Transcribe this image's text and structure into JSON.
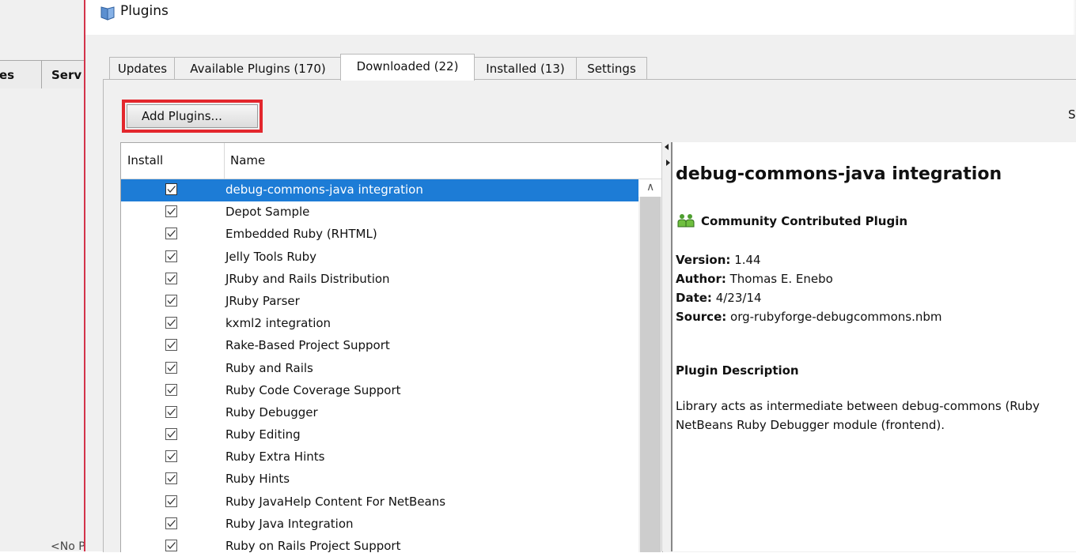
{
  "ide": {
    "tabs": [
      "es",
      "Serv"
    ],
    "placeholder": "<No P"
  },
  "dialog": {
    "title": "Plugins",
    "tabs": [
      {
        "label": "Updates"
      },
      {
        "label": "Available Plugins (170)"
      },
      {
        "label": "Downloaded (22)"
      },
      {
        "label": "Installed (13)"
      },
      {
        "label": "Settings"
      }
    ],
    "active_tab": "Downloaded (22)",
    "add_button": "Add Plugins...",
    "right_edge_text": "S",
    "table": {
      "headers": {
        "install": "Install",
        "name": "Name"
      },
      "rows": [
        {
          "name": "debug-commons-java integration",
          "checked": true,
          "selected": true
        },
        {
          "name": "Depot Sample",
          "checked": true
        },
        {
          "name": "Embedded Ruby (RHTML)",
          "checked": true
        },
        {
          "name": "Jelly Tools Ruby",
          "checked": true
        },
        {
          "name": "JRuby and Rails Distribution",
          "checked": true
        },
        {
          "name": "JRuby Parser",
          "checked": true
        },
        {
          "name": "kxml2 integration",
          "checked": true
        },
        {
          "name": "Rake-Based Project Support",
          "checked": true
        },
        {
          "name": "Ruby and Rails",
          "checked": true
        },
        {
          "name": "Ruby Code Coverage Support",
          "checked": true
        },
        {
          "name": "Ruby Debugger",
          "checked": true
        },
        {
          "name": "Ruby Editing",
          "checked": true
        },
        {
          "name": "Ruby Extra Hints",
          "checked": true
        },
        {
          "name": "Ruby Hints",
          "checked": true
        },
        {
          "name": "Ruby JavaHelp Content For NetBeans",
          "checked": true
        },
        {
          "name": "Ruby Java Integration",
          "checked": true
        },
        {
          "name": "Ruby on Rails Project Support",
          "checked": true
        }
      ]
    },
    "detail": {
      "title": "debug-commons-java integration",
      "badge": "Community Contributed Plugin",
      "version_label": "Version:",
      "version": "1.44",
      "author_label": "Author:",
      "author": "Thomas E. Enebo",
      "date_label": "Date:",
      "date": "4/23/14",
      "source_label": "Source:",
      "source": "org-rubyforge-debugcommons.nbm",
      "description_heading": "Plugin Description",
      "description_line1": "Library acts as intermediate between debug-commons (Ruby",
      "description_line2": "NetBeans Ruby Debugger module (frontend)."
    }
  },
  "colors": {
    "selection": "#1d7cd6",
    "highlight_border": "#e3272d",
    "dialog_edge": "#d3334a"
  }
}
